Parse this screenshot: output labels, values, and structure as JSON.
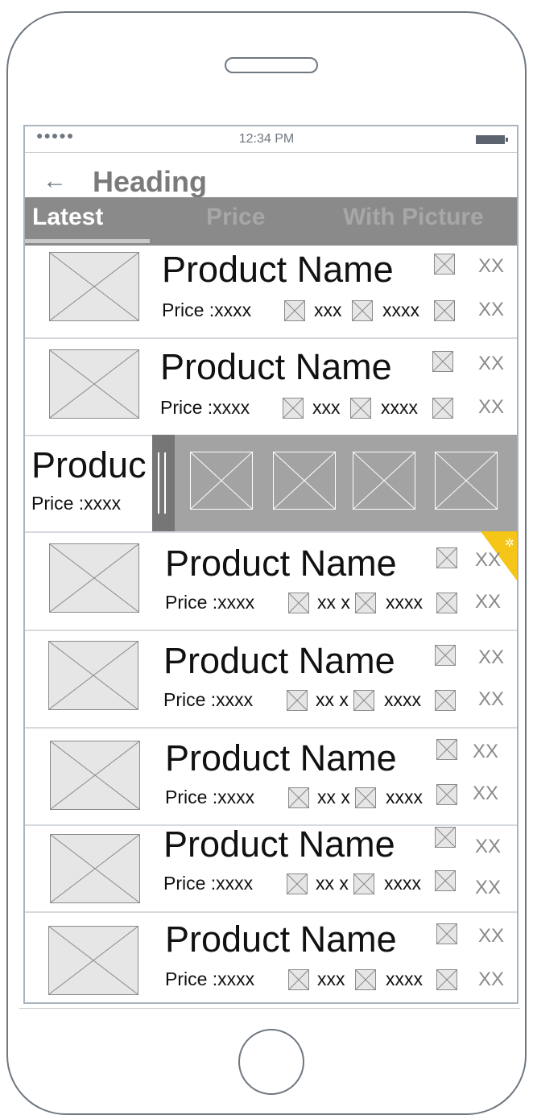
{
  "status": {
    "signal": "●●●●●",
    "time": "12:34 PM"
  },
  "header": {
    "back_icon": "back-arrow-icon",
    "title": "Heading"
  },
  "tabs": [
    {
      "label": "Latest",
      "active": true
    },
    {
      "label": "Price",
      "active": false
    },
    {
      "label": "With Picture",
      "active": false
    }
  ],
  "products": [
    {
      "name": "Product Name",
      "price": "Price :xxxx",
      "meta1": "xxx",
      "meta2": "xxxx",
      "xx_top": "XX",
      "xx_bottom": "XX"
    },
    {
      "name": "Product Name",
      "price": "Price :xxxx",
      "meta1": "xxx",
      "meta2": "xxxx",
      "xx_top": "XX",
      "xx_bottom": "XX"
    },
    {
      "name": "Product Name",
      "price": "Price :xxxx",
      "meta1": "xx x",
      "meta2": "xxxx",
      "xx_top": "XX",
      "xx_bottom": "XX"
    },
    {
      "name": "Product Name",
      "price": "Price :xxxx",
      "meta1": "xx x",
      "meta2": "xxxx",
      "xx_top": "XX",
      "xx_bottom": "XX"
    },
    {
      "name": "Product Name",
      "price": "Price :xxxx",
      "meta1": "xx x",
      "meta2": "xxxx",
      "xx_top": "XX",
      "xx_bottom": "XX"
    },
    {
      "name": "Product Name",
      "price": "Price :xxxx",
      "meta1": "xx x",
      "meta2": "xxxx",
      "xx_top": "XX",
      "xx_bottom": "XX"
    },
    {
      "name": "Product Name",
      "price": "Price :xxxx",
      "meta1": "xxx",
      "meta2": "xxxx",
      "xx_top": "XX",
      "xx_bottom": "XX"
    }
  ],
  "swipe_item": {
    "name": "Produc",
    "price": "Price :xxxx",
    "actions": 4
  },
  "colors": {
    "tab_bar": "#8a8a8a",
    "tab_active": "#ffffff",
    "tab_inactive": "#a7a7a7",
    "flag": "#f5c518",
    "swipe_panel": "#a3a3a3"
  }
}
